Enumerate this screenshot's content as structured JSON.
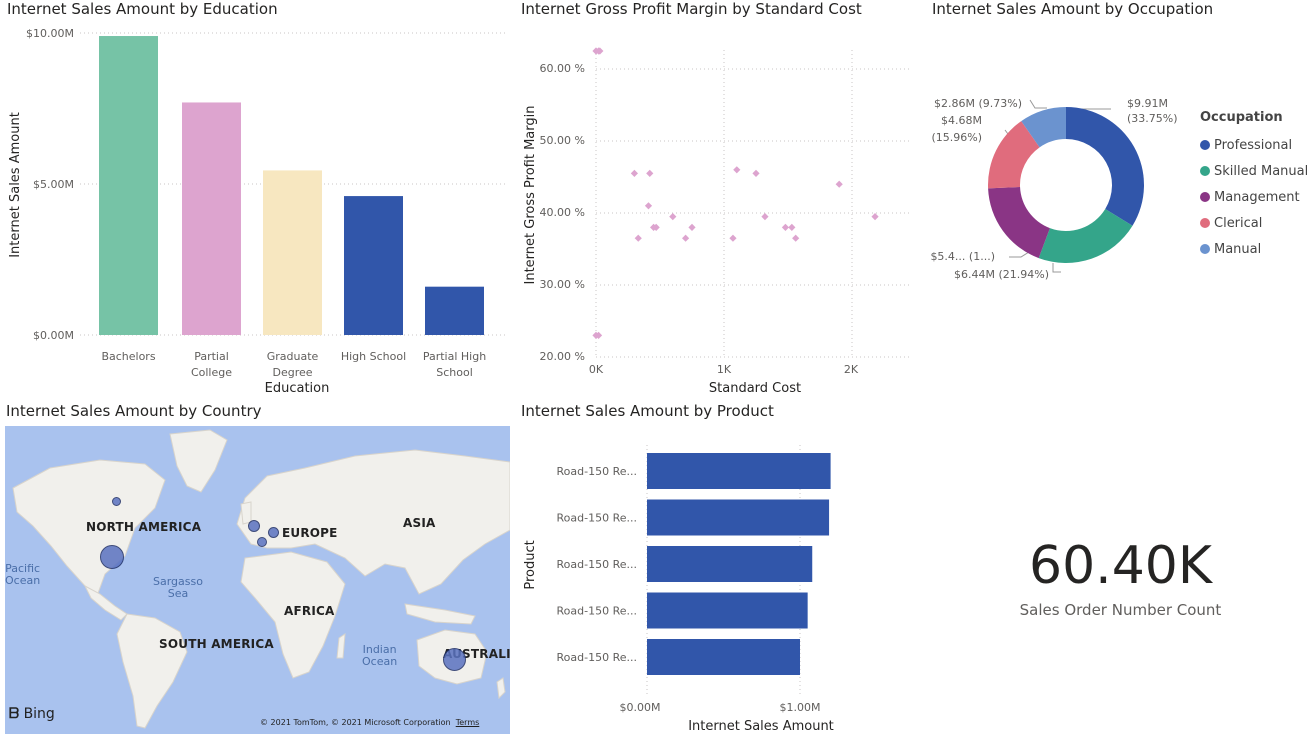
{
  "education_chart": {
    "title": "Internet Sales Amount by Education",
    "ylabel": "Internet Sales Amount",
    "xlabel": "Education",
    "y_ticks": [
      "$10.00M",
      "$5.00M",
      "$0.00M"
    ]
  },
  "margin_chart": {
    "title": "Internet Gross Profit Margin by Standard Cost",
    "ylabel": "Internet Gross Profit Margin",
    "xlabel": "Standard Cost",
    "y_ticks": [
      "60.00 %",
      "50.00 %",
      "40.00 %",
      "30.00 %",
      "20.00 %"
    ],
    "x_ticks": [
      "0K",
      "1K",
      "2K"
    ]
  },
  "occupation_chart": {
    "title": "Internet Sales Amount by Occupation",
    "legend_title": "Occupation",
    "labels": [
      {
        "line1": "$9.91M",
        "line2": "(33.75%)"
      },
      {
        "line1": "$6.44M (21.94%)",
        "line2": ""
      },
      {
        "line1": "$5.4... (1...)",
        "line2": ""
      },
      {
        "line1": "$4.68M",
        "line2": "(15.96%)"
      },
      {
        "line1": "$2.86M (9.73%)",
        "line2": ""
      }
    ]
  },
  "country_map": {
    "title": "Internet Sales Amount by Country",
    "regions": [
      "NORTH AMERICA",
      "EUROPE",
      "ASIA",
      "AFRICA",
      "SOUTH AMERICA",
      "AUSTRALIA"
    ],
    "oceans": [
      "Pacific\nOcean",
      "Sargasso\nSea",
      "Indian\nOcean"
    ],
    "provider": "Bing",
    "copyright": "© 2021 TomTom, © 2021 Microsoft Corporation",
    "terms": "Terms"
  },
  "product_chart": {
    "title": "Internet Sales Amount by Product",
    "ylabel": "Product",
    "xlabel": "Internet Sales Amount",
    "x_ticks": [
      "$0.00M",
      "$1.00M"
    ]
  },
  "card": {
    "value": "60.40K",
    "label": "Sales Order Number Count"
  },
  "colors": {
    "teal": "#76c3a6",
    "pink": "#dda4cf",
    "cream": "#f7e7c0",
    "navy": "#3156aa",
    "scatter": "#dda4cf",
    "professional": "#3156aa",
    "skilled_manual": "#34a58a",
    "management": "#8a3585",
    "clerical": "#e06c7d",
    "manual": "#6b93cf"
  },
  "chart_data": [
    {
      "type": "bar",
      "title": "Internet Sales Amount by Education",
      "xlabel": "Education",
      "ylabel": "Internet Sales Amount",
      "categories": [
        "Bachelors",
        "Partial College",
        "Graduate Degree",
        "High School",
        "Partial High School"
      ],
      "values": [
        9.9,
        7.7,
        5.45,
        4.6,
        1.6
      ],
      "colors": [
        "#76c3a6",
        "#dda4cf",
        "#f7e7c0",
        "#3156aa",
        "#3156aa"
      ],
      "ylim": [
        0,
        10
      ],
      "grid": true
    },
    {
      "type": "scatter",
      "title": "Internet Gross Profit Margin by Standard Cost",
      "xlabel": "Standard Cost",
      "ylabel": "Internet Gross Profit Margin",
      "xlim": [
        0,
        2500
      ],
      "ylim": [
        20,
        65
      ],
      "points": [
        [
          0,
          62.5
        ],
        [
          20,
          62.5
        ],
        [
          30,
          62.5
        ],
        [
          0,
          23
        ],
        [
          20,
          23
        ],
        [
          300,
          45.5
        ],
        [
          420,
          45.5
        ],
        [
          330,
          36.5
        ],
        [
          410,
          41
        ],
        [
          450,
          38
        ],
        [
          470,
          38
        ],
        [
          600,
          39.5
        ],
        [
          700,
          36.5
        ],
        [
          750,
          38
        ],
        [
          1070,
          36.5
        ],
        [
          1100,
          46
        ],
        [
          1250,
          45.5
        ],
        [
          1320,
          39.5
        ],
        [
          1480,
          38
        ],
        [
          1530,
          38
        ],
        [
          1560,
          36.5
        ],
        [
          1900,
          44
        ],
        [
          2180,
          39.5
        ]
      ],
      "grid": true
    },
    {
      "type": "pie",
      "title": "Internet Sales Amount by Occupation",
      "legend": "right",
      "categories": [
        "Professional",
        "Skilled Manual",
        "Management",
        "Clerical",
        "Manual"
      ],
      "values": [
        33.75,
        21.94,
        18.62,
        15.96,
        9.73
      ],
      "colors": [
        "#3156aa",
        "#34a58a",
        "#8a3585",
        "#e06c7d",
        "#6b93cf"
      ]
    },
    {
      "type": "bar",
      "title": "Internet Sales Amount by Product",
      "orientation": "horizontal",
      "xlabel": "Internet Sales Amount",
      "ylabel": "Product",
      "categories": [
        "Road-150 Re...",
        "Road-150 Re...",
        "Road-150 Re...",
        "Road-150 Re...",
        "Road-150 Re..."
      ],
      "values": [
        1.2,
        1.19,
        1.08,
        1.05,
        1.0
      ],
      "xlim": [
        0,
        1.3
      ],
      "grid": true
    },
    {
      "type": "scatter",
      "title": "Internet Sales Amount by Country",
      "categories": [
        "United States",
        "Canada",
        "United Kingdom",
        "Germany",
        "France",
        "Australia"
      ],
      "relative_size": [
        9.4,
        1.9,
        3.4,
        2.8,
        2.6,
        9.1
      ]
    }
  ]
}
